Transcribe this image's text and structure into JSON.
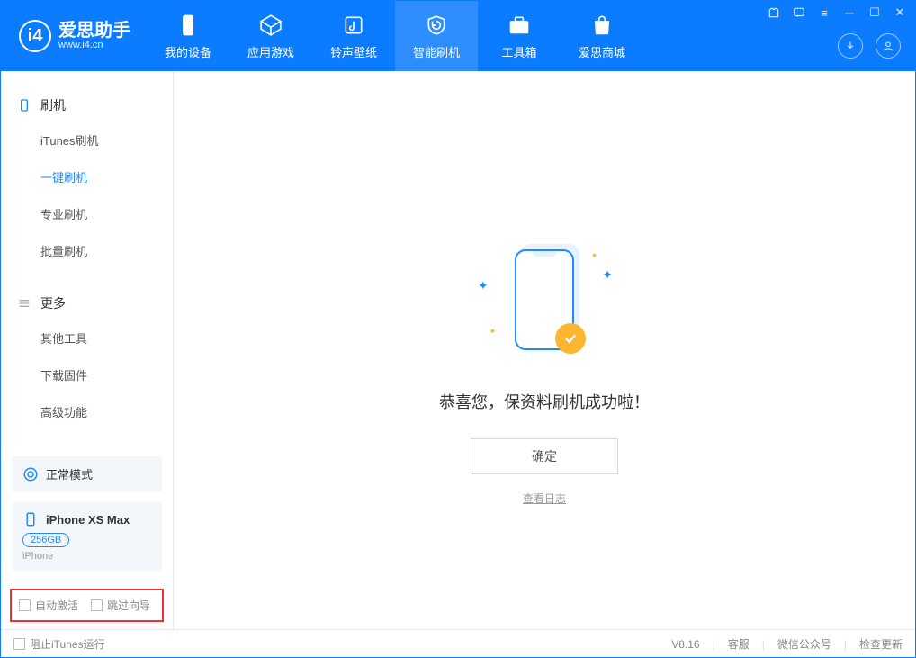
{
  "app": {
    "title": "爱思助手",
    "url": "www.i4.cn"
  },
  "nav": {
    "mydevice": "我的设备",
    "apps": "应用游戏",
    "ringtones": "铃声壁纸",
    "flash": "智能刷机",
    "toolbox": "工具箱",
    "store": "爱思商城"
  },
  "sidebar": {
    "section_flash": "刷机",
    "itunes_flash": "iTunes刷机",
    "oneclick_flash": "一键刷机",
    "pro_flash": "专业刷机",
    "batch_flash": "批量刷机",
    "section_more": "更多",
    "other_tools": "其他工具",
    "download_fw": "下载固件",
    "advanced": "高级功能",
    "mode_card": "正常模式",
    "device": {
      "name": "iPhone XS Max",
      "storage": "256GB",
      "type": "iPhone"
    },
    "auto_activate": "自动激活",
    "skip_guide": "跳过向导"
  },
  "main": {
    "success": "恭喜您，保资料刷机成功啦！",
    "ok": "确定",
    "view_log": "查看日志"
  },
  "footer": {
    "block_itunes": "阻止iTunes运行",
    "version": "V8.16",
    "support": "客服",
    "wechat": "微信公众号",
    "check_update": "检查更新"
  }
}
